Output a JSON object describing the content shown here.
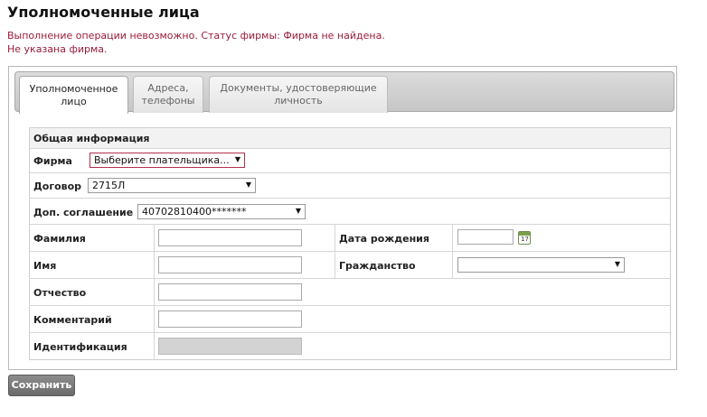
{
  "page": {
    "title": "Уполномоченные лица",
    "errors": [
      "Выполнение операции невозможно. Статус фирмы: Фирма не найдена.",
      "Не указана фирма."
    ]
  },
  "tabs": [
    {
      "label_line1": "Уполномоченное",
      "label_line2": "лицо",
      "active": true
    },
    {
      "label_line1": "Адреса,",
      "label_line2": "телефоны",
      "active": false
    },
    {
      "label_line1": "Документы, удостоверяющие",
      "label_line2": "личность",
      "active": false
    }
  ],
  "form": {
    "section_title": "Общая информация",
    "firm": {
      "label": "Фирма",
      "value": "Выберите плательщика..."
    },
    "contract": {
      "label": "Договор",
      "value": "2715Л"
    },
    "agreement": {
      "label": "Доп. соглашение",
      "value": "40702810400*******"
    },
    "surname": {
      "label": "Фамилия",
      "value": ""
    },
    "name": {
      "label": "Имя",
      "value": ""
    },
    "patronymic": {
      "label": "Отчество",
      "value": ""
    },
    "comment": {
      "label": "Комментарий",
      "value": ""
    },
    "identification": {
      "label": "Идентификация",
      "value": ""
    },
    "birth_date": {
      "label": "Дата рождения",
      "value": ""
    },
    "citizenship": {
      "label": "Гражданство",
      "value": ""
    }
  },
  "calendar_icon": {
    "day": "17"
  },
  "actions": {
    "save_label": "Сохранить"
  },
  "colors": {
    "error": "#9a1c3a",
    "firm_select_border": "#b5304c",
    "button": "#7a7a7a"
  }
}
